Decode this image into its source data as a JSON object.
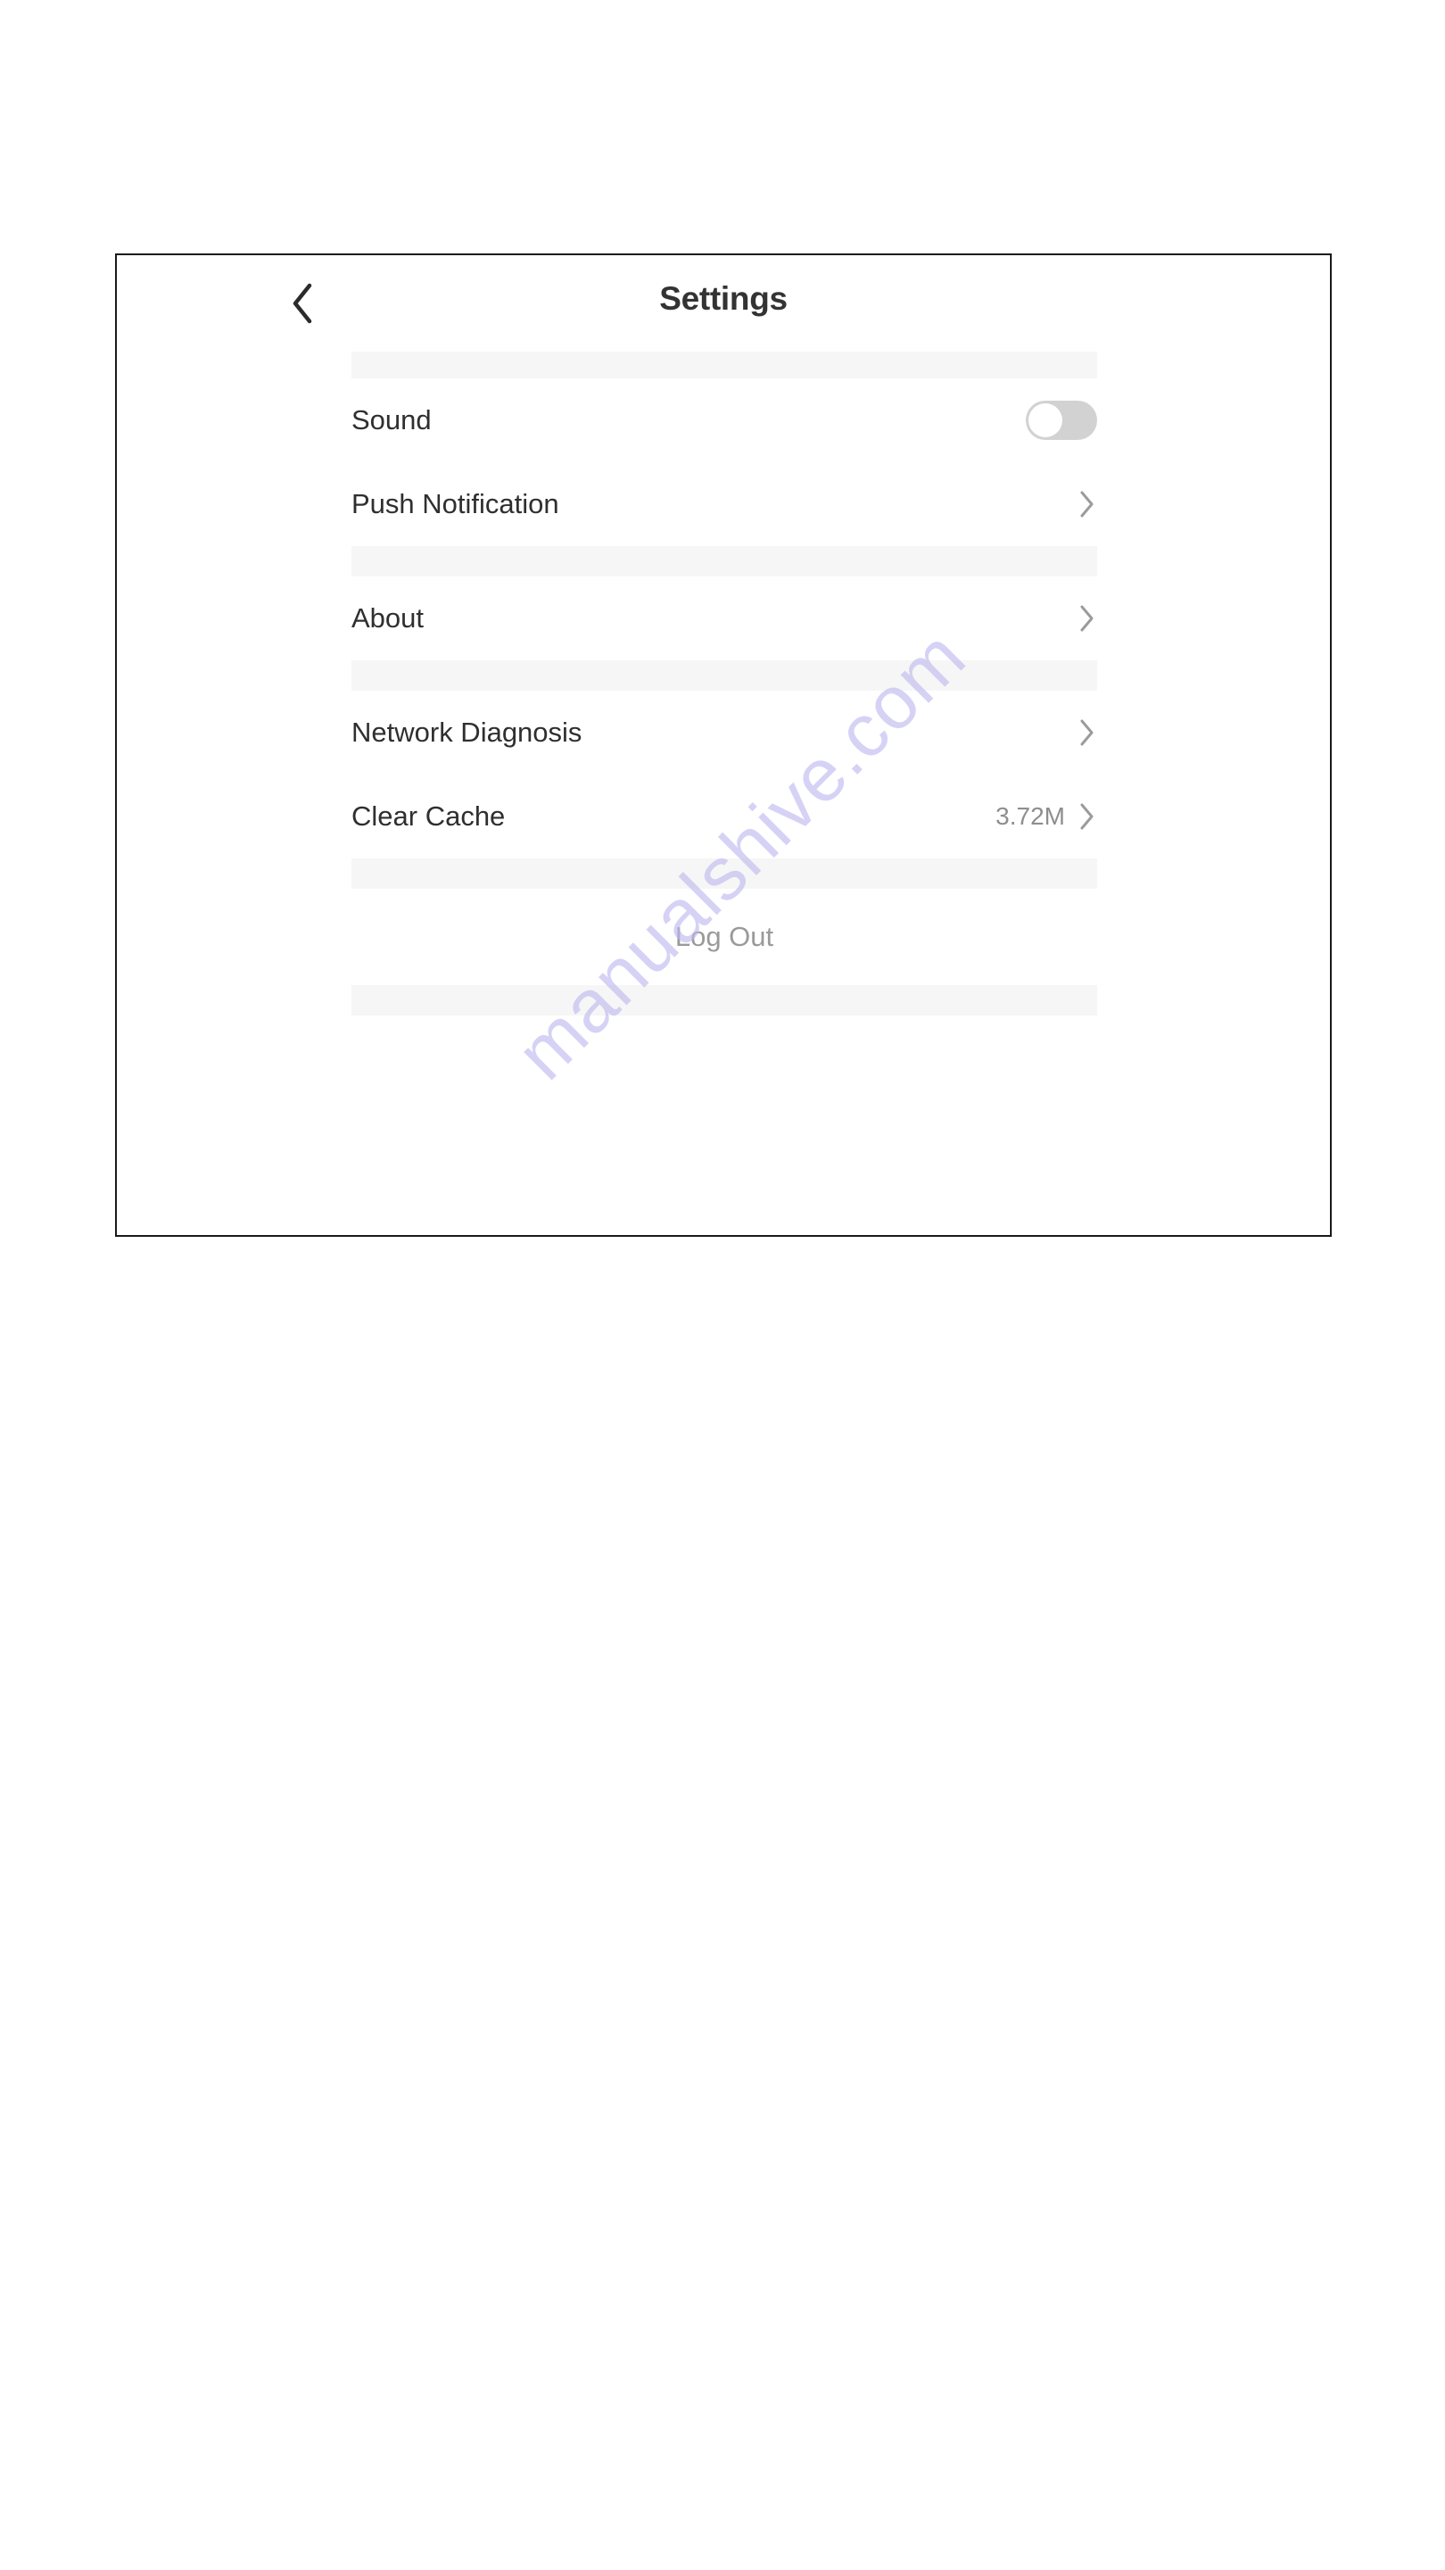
{
  "header": {
    "title": "Settings",
    "back_icon": "chevron-left-icon"
  },
  "sections": [
    {
      "rows": [
        {
          "label": "Sound",
          "control": "toggle",
          "toggle_on": false
        },
        {
          "label": "Push Notification",
          "control": "chevron",
          "chevron_icon": "chevron-right-icon"
        }
      ]
    },
    {
      "rows": [
        {
          "label": "About",
          "control": "chevron",
          "chevron_icon": "chevron-right-icon"
        }
      ]
    },
    {
      "rows": [
        {
          "label": "Network Diagnosis",
          "control": "chevron",
          "chevron_icon": "chevron-right-icon"
        },
        {
          "label": "Clear Cache",
          "control": "chevron",
          "value": "3.72M",
          "chevron_icon": "chevron-right-icon"
        }
      ]
    }
  ],
  "logout": {
    "label": "Log Out"
  },
  "watermark": {
    "text": "manualshive.com"
  },
  "colors": {
    "page_background": "#ffffff",
    "frame_border": "#1a1a1a",
    "band": "#f6f6f6",
    "title_text": "#333333",
    "row_text": "#2f2f2f",
    "muted_text": "#8e8e8e",
    "logout_text": "#9a9a9a",
    "toggle_track_off": "#d2d2d2",
    "toggle_knob": "#ffffff",
    "chevron": "#9b9b9b",
    "watermark": "#bdb8ef"
  }
}
